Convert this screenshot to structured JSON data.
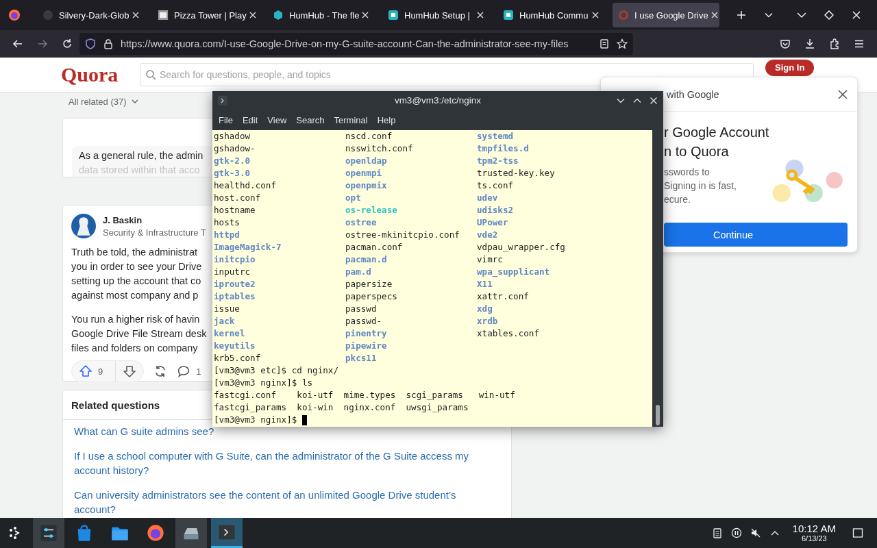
{
  "browser": {
    "tabs": [
      {
        "title": "Silvery-Dark-Glob",
        "kind": "dim",
        "selected": false
      },
      {
        "title": "Pizza Tower | Play",
        "kind": "image",
        "selected": false
      },
      {
        "title": "HumHub - The fle",
        "kind": "hex",
        "selected": false
      },
      {
        "title": "HumHub Setup |",
        "kind": "box",
        "selected": false
      },
      {
        "title": "HumHub Commu",
        "kind": "box",
        "selected": false
      },
      {
        "title": "I use Google Drive",
        "kind": "ring",
        "selected": true
      }
    ],
    "url": "https://www.quora.com/I-use-Google-Drive-on-my-G-suite-account-Can-the-administrator-see-my-files",
    "forward_disabled": true
  },
  "quora": {
    "logo": "Quora",
    "search_placeholder": "Search for questions, people, and topics",
    "sign_in": "Sign In",
    "filter": "All related (37)",
    "preview": {
      "line": "As a general rule, the admin",
      "faded_line": "data stored within that acco"
    },
    "answer": {
      "author": "J. Baskin",
      "credential": "Security & Infrastructure T",
      "paragraphs": [
        [
          "Truth be told, the administrat",
          "you in order to see your Drive",
          "setting up the account that co",
          "against most company and p"
        ],
        [
          "You run a higher risk of havin",
          "Google Drive File Stream desk",
          "files and folders on company"
        ]
      ],
      "upvotes": "9",
      "comments": "1"
    },
    "related": {
      "title": "Related questions",
      "questions": [
        "What can G suite admins see?",
        "If I use a school computer with G Suite, can the administrator of the G Suite access my account history?",
        "Can university administrators see the content of an unlimited Google Drive student’s account?"
      ]
    }
  },
  "terminal": {
    "title": "vm3@vm3:/etc/nginx",
    "menu": [
      "File",
      "Edit",
      "View",
      "Search",
      "Terminal",
      "Help"
    ],
    "listing": [
      [
        {
          "name": "gshadow",
          "kind": "file"
        },
        {
          "name": "nscd.conf",
          "kind": "file"
        },
        {
          "name": "systemd",
          "kind": "dir"
        }
      ],
      [
        {
          "name": "gshadow-",
          "kind": "file"
        },
        {
          "name": "nsswitch.conf",
          "kind": "file"
        },
        {
          "name": "tmpfiles.d",
          "kind": "dir"
        }
      ],
      [
        {
          "name": "gtk-2.0",
          "kind": "dir"
        },
        {
          "name": "openldap",
          "kind": "dir"
        },
        {
          "name": "tpm2-tss",
          "kind": "dir"
        }
      ],
      [
        {
          "name": "gtk-3.0",
          "kind": "dir"
        },
        {
          "name": "openmpi",
          "kind": "dir"
        },
        {
          "name": "trusted-key.key",
          "kind": "file"
        }
      ],
      [
        {
          "name": "healthd.conf",
          "kind": "file"
        },
        {
          "name": "openpmix",
          "kind": "dir"
        },
        {
          "name": "ts.conf",
          "kind": "file"
        }
      ],
      [
        {
          "name": "host.conf",
          "kind": "file"
        },
        {
          "name": "opt",
          "kind": "dir"
        },
        {
          "name": "udev",
          "kind": "dir"
        }
      ],
      [
        {
          "name": "hostname",
          "kind": "file"
        },
        {
          "name": "os-release",
          "kind": "link"
        },
        {
          "name": "udisks2",
          "kind": "dir"
        }
      ],
      [
        {
          "name": "hosts",
          "kind": "file"
        },
        {
          "name": "ostree",
          "kind": "dir"
        },
        {
          "name": "UPower",
          "kind": "dir"
        }
      ],
      [
        {
          "name": "httpd",
          "kind": "dir"
        },
        {
          "name": "ostree-mkinitcpio.conf",
          "kind": "file"
        },
        {
          "name": "vde2",
          "kind": "dir"
        }
      ],
      [
        {
          "name": "ImageMagick-7",
          "kind": "dir"
        },
        {
          "name": "pacman.conf",
          "kind": "file"
        },
        {
          "name": "vdpau_wrapper.cfg",
          "kind": "file"
        }
      ],
      [
        {
          "name": "initcpio",
          "kind": "dir"
        },
        {
          "name": "pacman.d",
          "kind": "dir"
        },
        {
          "name": "vimrc",
          "kind": "file"
        }
      ],
      [
        {
          "name": "inputrc",
          "kind": "file"
        },
        {
          "name": "pam.d",
          "kind": "dir"
        },
        {
          "name": "wpa_supplicant",
          "kind": "dir"
        }
      ],
      [
        {
          "name": "iproute2",
          "kind": "dir"
        },
        {
          "name": "papersize",
          "kind": "file"
        },
        {
          "name": "X11",
          "kind": "dir"
        }
      ],
      [
        {
          "name": "iptables",
          "kind": "dir"
        },
        {
          "name": "paperspecs",
          "kind": "file"
        },
        {
          "name": "xattr.conf",
          "kind": "file"
        }
      ],
      [
        {
          "name": "issue",
          "kind": "file"
        },
        {
          "name": "passwd",
          "kind": "file"
        },
        {
          "name": "xdg",
          "kind": "dir"
        }
      ],
      [
        {
          "name": "jack",
          "kind": "dir"
        },
        {
          "name": "passwd-",
          "kind": "file"
        },
        {
          "name": "xrdb",
          "kind": "dir"
        }
      ],
      [
        {
          "name": "kernel",
          "kind": "dir"
        },
        {
          "name": "pinentry",
          "kind": "dir"
        },
        {
          "name": "xtables.conf",
          "kind": "file"
        }
      ],
      [
        {
          "name": "keyutils",
          "kind": "dir"
        },
        {
          "name": "pipewire",
          "kind": "dir"
        }
      ],
      [
        {
          "name": "krb5.conf",
          "kind": "file"
        },
        {
          "name": "pkcs11",
          "kind": "dir"
        }
      ]
    ],
    "commands": [
      "[vm3@vm3 etc]$ cd nginx/",
      "[vm3@vm3 nginx]$ ls"
    ],
    "ls_output": [
      [
        "fastcgi.conf",
        "koi-utf",
        "mime.types",
        "scgi_params",
        "win-utf"
      ],
      [
        "fastcgi_params",
        "koi-win",
        "nginx.conf",
        "uwsgi_params"
      ]
    ],
    "prompt": "[vm3@vm3 nginx]$"
  },
  "google_popup": {
    "header": "with Google",
    "title_lines": [
      "r Google Account",
      "n to Quora"
    ],
    "body_lines": [
      "sswords to",
      "Signing in is fast,",
      "ecure."
    ],
    "button": "Continue"
  },
  "taskbar": {
    "apps": [
      {
        "kind": "settings",
        "open": true,
        "focused": false
      },
      {
        "kind": "store",
        "open": false,
        "focused": false
      },
      {
        "kind": "files",
        "open": false,
        "focused": false
      },
      {
        "kind": "firefox",
        "open": false,
        "focused": false
      },
      {
        "kind": "scanner",
        "open": true,
        "focused": false
      },
      {
        "kind": "terminal",
        "open": true,
        "focused": true
      }
    ],
    "time": "10:12 AM",
    "date": "6/13/23"
  }
}
